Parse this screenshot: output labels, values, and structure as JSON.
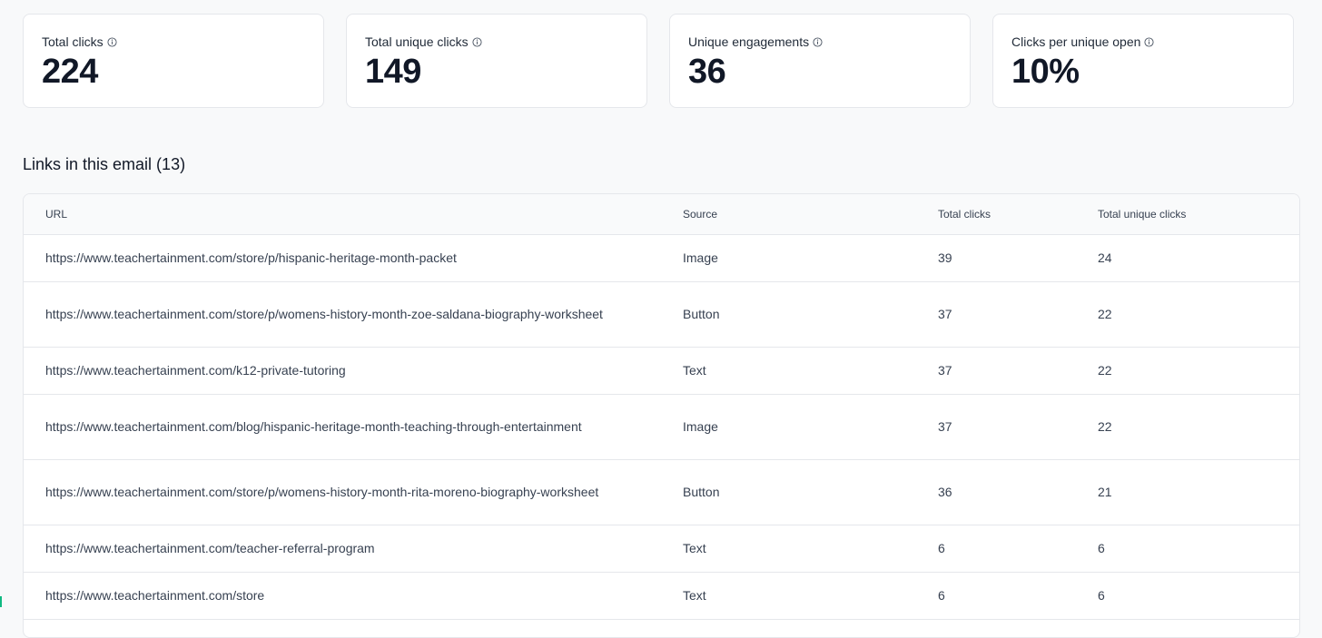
{
  "stats": [
    {
      "label": "Total clicks",
      "value": "224"
    },
    {
      "label": "Total unique clicks",
      "value": "149"
    },
    {
      "label": "Unique engagements",
      "value": "36"
    },
    {
      "label": "Clicks per unique open",
      "value": "10%"
    }
  ],
  "section": {
    "title": "Links in this email (13)"
  },
  "table": {
    "headers": {
      "url": "URL",
      "source": "Source",
      "total_clicks": "Total clicks",
      "total_unique_clicks": "Total unique clicks"
    },
    "rows": [
      {
        "url": "https://www.teachertainment.com/store/p/hispanic-heritage-month-packet",
        "source": "Image",
        "total_clicks": "39",
        "total_unique_clicks": "24"
      },
      {
        "url": "https://www.teachertainment.com/store/p/womens-history-month-zoe-saldana-biography-worksheet",
        "source": "Button",
        "total_clicks": "37",
        "total_unique_clicks": "22"
      },
      {
        "url": "https://www.teachertainment.com/k12-private-tutoring",
        "source": "Text",
        "total_clicks": "37",
        "total_unique_clicks": "22"
      },
      {
        "url": "https://www.teachertainment.com/blog/hispanic-heritage-month-teaching-through-entertainment",
        "source": "Image",
        "total_clicks": "37",
        "total_unique_clicks": "22"
      },
      {
        "url": "https://www.teachertainment.com/store/p/womens-history-month-rita-moreno-biography-worksheet",
        "source": "Button",
        "total_clicks": "36",
        "total_unique_clicks": "21"
      },
      {
        "url": "https://www.teachertainment.com/teacher-referral-program",
        "source": "Text",
        "total_clicks": "6",
        "total_unique_clicks": "6"
      },
      {
        "url": "https://www.teachertainment.com/store",
        "source": "Text",
        "total_clicks": "6",
        "total_unique_clicks": "6"
      }
    ]
  },
  "icons": {
    "stat_info": "info-circle-icon"
  },
  "colors": {
    "background": "#f8f9fa",
    "card": "#ffffff",
    "border": "#e5e7eb",
    "accent": "#10b981"
  }
}
